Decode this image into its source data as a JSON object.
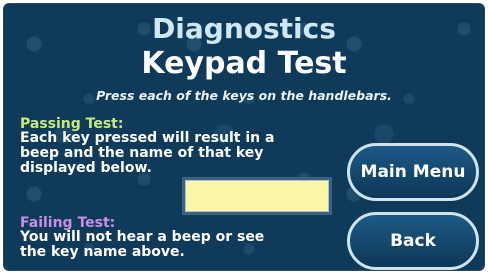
{
  "header": {
    "title": "Diagnostics",
    "subtitle": "Keypad Test",
    "instructions": "Press each of the keys on the handlebars."
  },
  "passing": {
    "heading": "Passing Test:",
    "lines": [
      "Each key pressed will result in a",
      "beep and the name of that key",
      "displayed below."
    ]
  },
  "key_display": {
    "value": ""
  },
  "failing": {
    "heading": "Failing Test:",
    "lines": [
      "You will not hear a beep or see",
      "the key name above."
    ]
  },
  "buttons": {
    "main_menu": "Main Menu",
    "back": "Back"
  },
  "colors": {
    "background": "#0f3a5a",
    "passing_heading": "#c9ea7c",
    "failing_heading": "#c98ee6",
    "display_fill": "#fbf6a6"
  }
}
